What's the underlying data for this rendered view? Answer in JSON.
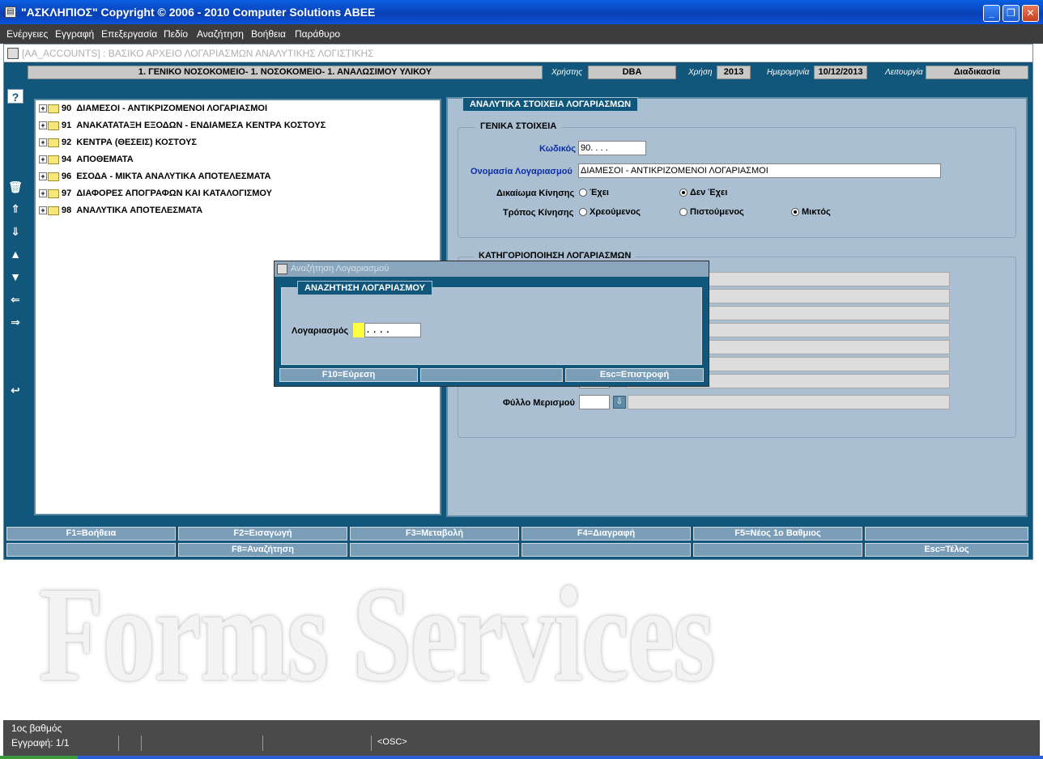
{
  "window": {
    "title": "\"ΑΣΚΛΗΠΙΟΣ\" Copyright © 2006 - 2010 Computer Solutions ABEE",
    "minimize": "_",
    "restore": "❐",
    "close": "✕"
  },
  "menu": [
    "Ενέργειες",
    "Εγγραφή",
    "Επεξεργασία",
    "Πεδίο",
    "Αναζήτηση",
    "Βοήθεια",
    "Παράθυρο"
  ],
  "form": {
    "title": "[AA_ACCOUNTS]  :  ΒΑΣΙΚΟ ΑΡΧΕΙΟ ΛΟΓΑΡΙΑΣΜΩΝ ΑΝΑΛΥΤΙΚΗΣ ΛΟΓΙΣΤΙΚΗΣ"
  },
  "infobar": {
    "org": "1. ΓΕΝΙΚΟ ΝΟΣΟΚΟΜΕΙΟ- 1. ΝΟΣΟΚΟΜΕΙΟ- 1. ΑΝΑΛΩΣΙΜΟΥ ΥΛΙΚΟΥ",
    "user_label": "Χρήστης",
    "user": "DBA",
    "year_label": "Χρήση",
    "year": "2013",
    "date_label": "Ημερομηνία",
    "date": "10/12/2013",
    "function_label": "Λειτουργία",
    "function": "Διαδικασία"
  },
  "toolbar": {
    "help": "?",
    "delete": "🗑",
    "first": "⇑",
    "last": "⇓",
    "up": "▲",
    "down": "▼",
    "prev": "⇐",
    "next": "⇒",
    "back": "↩"
  },
  "tree": [
    {
      "code": "90",
      "name": "ΔΙΑΜΕΣΟΙ - ΑΝΤΙΚΡΙΖΟΜΕΝΟΙ ΛΟΓΑΡΙΑΣΜΟΙ"
    },
    {
      "code": "91",
      "name": "ΑΝΑΚΑΤΑΤΑΞΗ ΕΞΟΔΩΝ - ΕΝΔΙΑΜΕΣΑ ΚΕΝΤΡΑ ΚΟΣΤΟΥΣ"
    },
    {
      "code": "92",
      "name": "ΚΕΝΤΡΑ (ΘΕΣΕΙΣ) ΚΟΣΤΟΥΣ"
    },
    {
      "code": "94",
      "name": "ΑΠΟΘΕΜΑΤΑ"
    },
    {
      "code": "96",
      "name": "ΕΣΟΔΑ - ΜΙΚΤΑ ΑΝΑΛΥΤΙΚΑ ΑΠΟΤΕΛΕΣΜΑΤΑ"
    },
    {
      "code": "97",
      "name": "ΔΙΑΦΟΡΕΣ ΑΠΟΓΡΑΦΩΝ ΚΑΙ ΚΑΤΑΛΟΓΙΣΜΟΥ"
    },
    {
      "code": "98",
      "name": "ΑΝΑΛΥΤΙΚΑ ΑΠΟΤΕΛΕΣΜΑΤΑ"
    }
  ],
  "details": {
    "tab": "ΑΝΑΛΥΤΙΚΑ ΣΤΟΙΧΕΙΑ ΛΟΓΑΡΙΑΣΜΩΝ",
    "general_group": "ΓΕΝΙΚΑ ΣΤΟΙΧΕΙΑ",
    "code_label": "Κωδικός",
    "code_value": "90.   .   .   .",
    "name_label": "Ονομασία Λογαριασμού",
    "name_value": "ΔΙΑΜΕΣΟΙ - ΑΝΤΙΚΡΙΖΟΜΕΝΟΙ ΛΟΓΑΡΙΑΣΜΟΙ",
    "movement_right_label": "Δικαίωμα Κίνησης",
    "movement_right_options": [
      "Έχει",
      "Δεν Έχει"
    ],
    "movement_right_selected": "Δεν Έχει",
    "movement_type_label": "Τρόπος Κίνησης",
    "movement_type_options": [
      "Χρεούμενος",
      "Πιστούμενος",
      "Μικτός"
    ],
    "movement_type_selected": "Μικτός",
    "category_group": "ΚΑΤΗΓΟΡΙΟΠΟΙΗΣΗ ΛΟΓΑΡΙΑΣΜΩΝ",
    "distribution_sheet_label": "Φύλλο Μερισμού",
    "distribution_sheet_value": ""
  },
  "dialog": {
    "title": "Αναζήτηση Λογαριασμού",
    "tab": "ΑΝΑΖΗΤΗΣΗ ΛΟΓΑΡΙΑΣΜΟΥ",
    "account_label": "Λογαριασμός",
    "account_value": ".   .   .   .",
    "find_button": "F10=Εύρεση",
    "blank_button": "",
    "return_button": "Esc=Επιστροφή"
  },
  "function_keys": {
    "row1": [
      "F1=Βοήθεια",
      "F2=Εισαγωγή",
      "F3=Μεταβολή",
      "F4=Διαγραφή",
      "F5=Νέος 1ο Βαθμιος",
      ""
    ],
    "row2": [
      "",
      "F8=Αναζήτηση",
      "",
      "",
      "",
      "Esc=Τέλος"
    ]
  },
  "watermark": "Forms Services",
  "status": {
    "level": "1ος βαθμός",
    "record": "Εγγραφή: 1/1",
    "mode": "<OSC>"
  },
  "colors": {
    "frame": "#11577c",
    "panel": "#aac0d2",
    "label_blue": "#0d2ea5",
    "focus_yellow": "#ffff40"
  }
}
